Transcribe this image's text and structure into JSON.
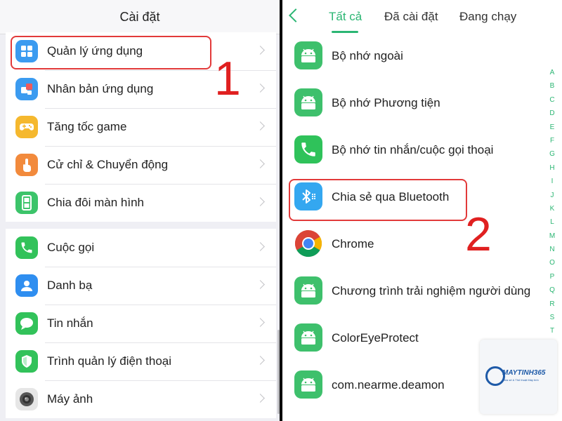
{
  "left": {
    "title": "Cài đặt",
    "group1": [
      {
        "label": "Quản lý ứng dụng",
        "icon": "grid-apps-icon",
        "color": "#3b9bf0"
      },
      {
        "label": "Nhân bản ứng dụng",
        "icon": "app-clone-icon",
        "color": "#3b9bf0"
      },
      {
        "label": "Tăng tốc game",
        "icon": "gamepad-icon",
        "color": "#f5b82e"
      },
      {
        "label": "Cử chỉ & Chuyển động",
        "icon": "hand-gesture-icon",
        "color": "#f28a3c"
      },
      {
        "label": "Chia đôi màn hình",
        "icon": "split-screen-icon",
        "color": "#3cc46a"
      }
    ],
    "group2": [
      {
        "label": "Cuộc gọi",
        "icon": "phone-icon",
        "color": "#32c25a"
      },
      {
        "label": "Danh bạ",
        "icon": "contacts-icon",
        "color": "#2f8ef0"
      },
      {
        "label": "Tin nhắn",
        "icon": "message-icon",
        "color": "#32c25a"
      },
      {
        "label": "Trình quản lý điện thoại",
        "icon": "shield-icon",
        "color": "#32c25a"
      },
      {
        "label": "Máy ảnh",
        "icon": "camera-icon",
        "color": "#888888"
      }
    ]
  },
  "right": {
    "tabs": [
      "Tất cả",
      "Đã cài đặt",
      "Đang chạy"
    ],
    "apps": [
      {
        "label": "Bộ nhớ ngoài",
        "icon": "android-icon",
        "color": "#3ec06c"
      },
      {
        "label": "Bộ nhớ Phương tiện",
        "icon": "android-icon",
        "color": "#3ec06c"
      },
      {
        "label": "Bộ nhớ tin nhắn/cuộc gọi thoại",
        "icon": "phone-icon",
        "color": "#2fc25a"
      },
      {
        "label": "Chia sẻ qua Bluetooth",
        "icon": "bluetooth-icon",
        "color": "#34a7f0"
      },
      {
        "label": "Chrome",
        "icon": "chrome-icon",
        "color": "#4285f4"
      },
      {
        "label": "Chương trình trải nghiệm người dùng",
        "icon": "android-icon",
        "color": "#3ec06c"
      },
      {
        "label": "ColorEyeProtect",
        "icon": "android-icon",
        "color": "#3ec06c"
      },
      {
        "label": "com.nearme.deamon",
        "icon": "android-icon",
        "color": "#3ec06c"
      }
    ],
    "alphabet": [
      "A",
      "B",
      "C",
      "D",
      "E",
      "F",
      "G",
      "H",
      "I",
      "J",
      "K",
      "L",
      "M",
      "N",
      "O",
      "P",
      "Q",
      "R",
      "S",
      "T"
    ]
  },
  "annotations": {
    "step1": "1",
    "step2": "2",
    "accent": "#e23a3a"
  },
  "watermark": {
    "brand": "MAYTINH365",
    "tagline": "Chia sẻ & Thủ thuật Máy tính"
  }
}
